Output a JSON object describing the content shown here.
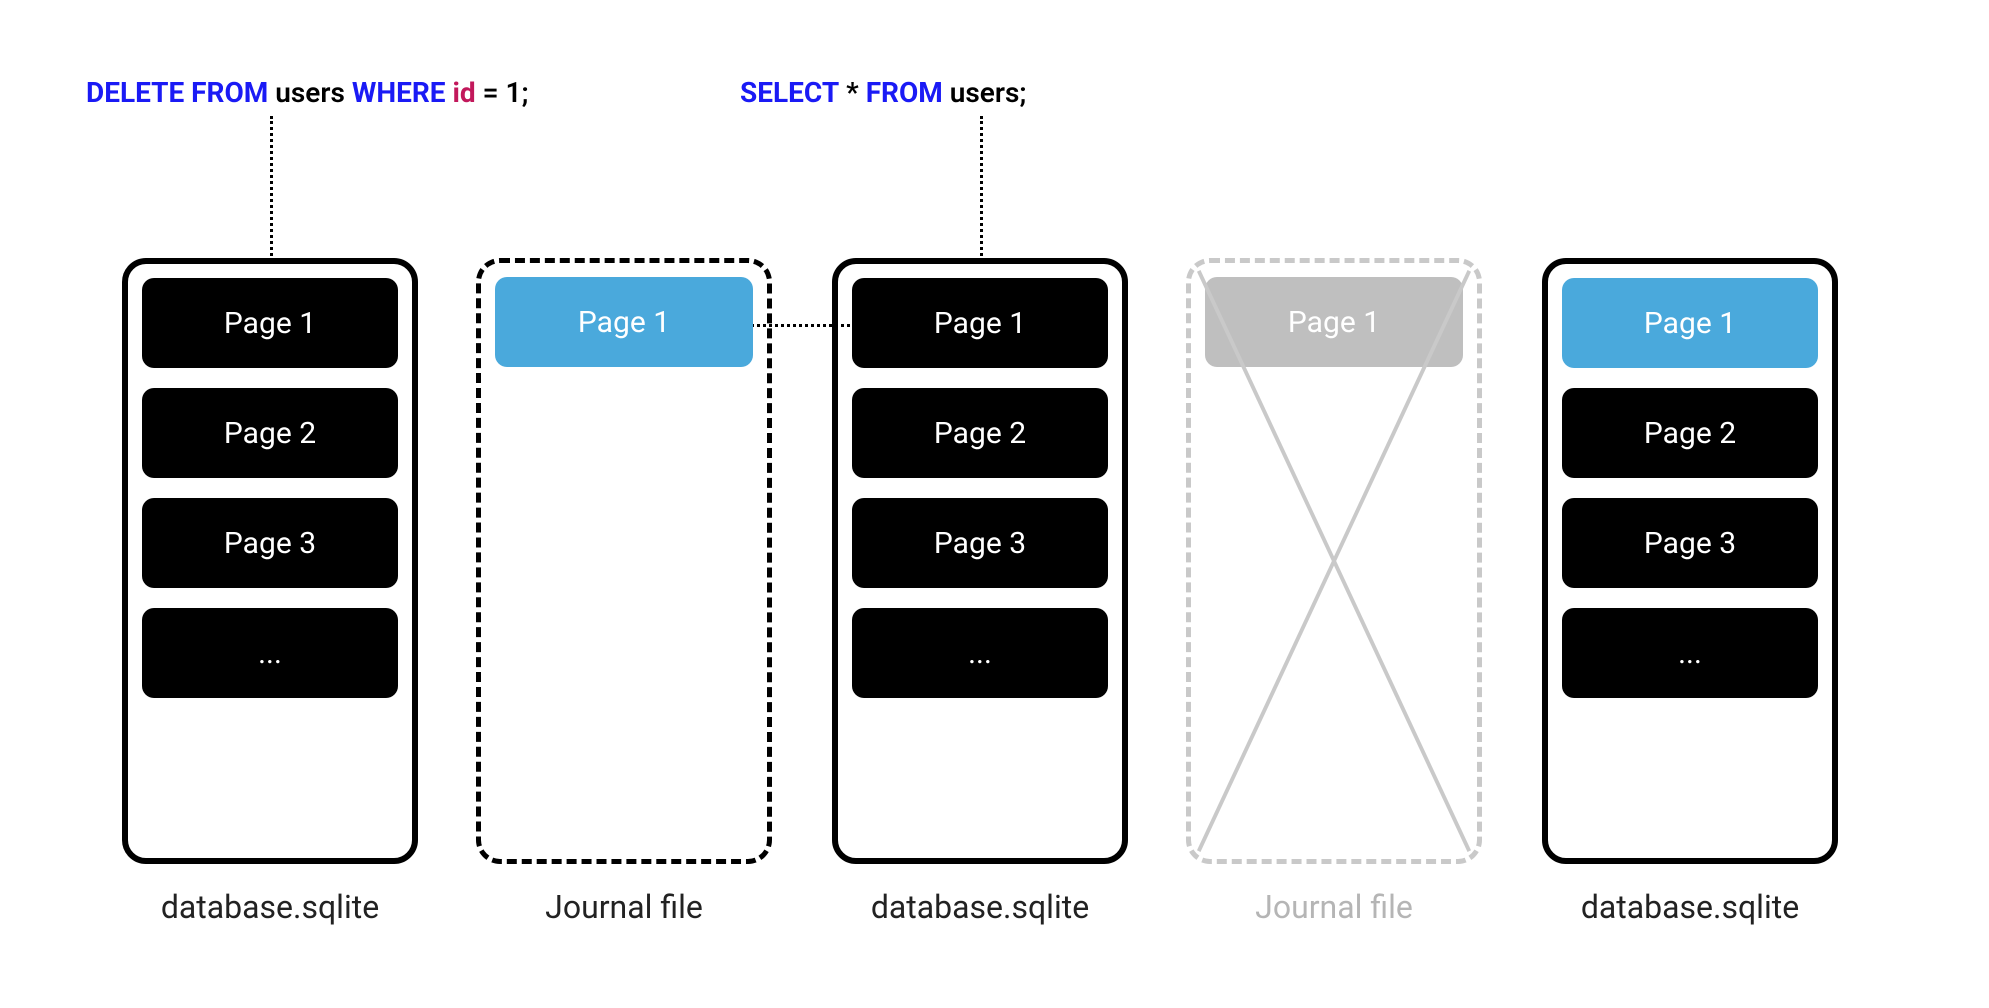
{
  "sql": {
    "delete": {
      "kw1": "DELETE FROM",
      "table": "users",
      "kw2": "WHERE",
      "col": "id",
      "eq": "=",
      "val": "1",
      "semi": ";"
    },
    "select": {
      "kw1": "SELECT",
      "star": "*",
      "kw2": "FROM",
      "table": "users",
      "semi": ";"
    }
  },
  "pages": {
    "p1": "Page 1",
    "p2": "Page 2",
    "p3": "Page 3",
    "ellipsis": "..."
  },
  "captions": {
    "db": "database.sqlite",
    "journal": "Journal file"
  },
  "colors": {
    "blue": "#4aa9dc",
    "faded": "#c9c9c9"
  }
}
